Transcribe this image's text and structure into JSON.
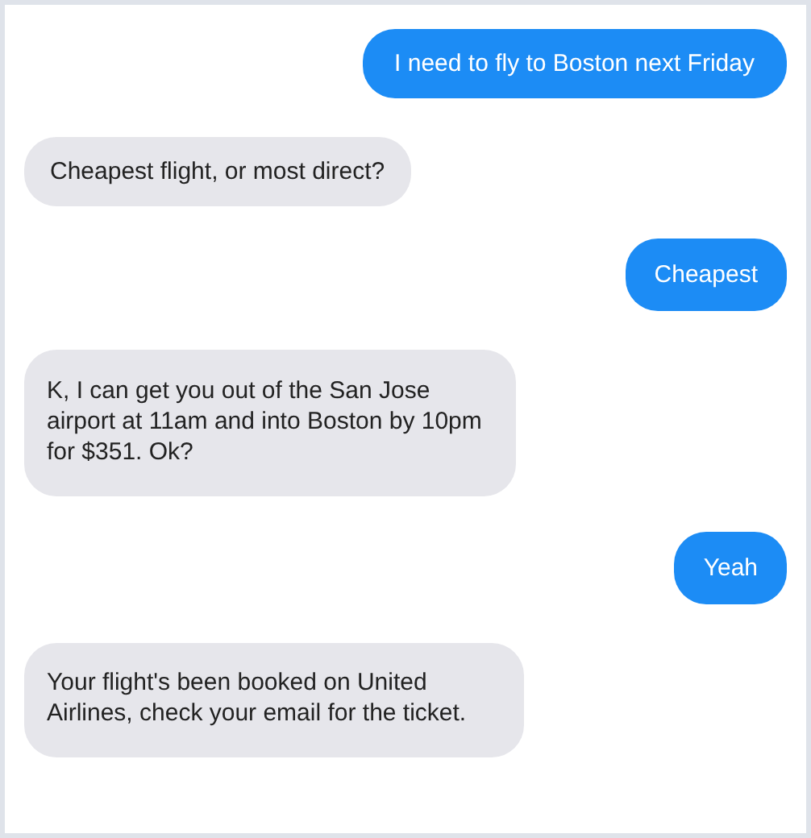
{
  "messages": [
    {
      "kind": "outgoing",
      "text": "I need to fly to Boston next Friday"
    },
    {
      "kind": "incoming",
      "text": "Cheapest flight, or most direct?"
    },
    {
      "kind": "outgoing",
      "text": "Cheapest"
    },
    {
      "kind": "incoming",
      "text": "K, I can get you out of the San Jose airport at 11am and into Boston by 10pm for $351. Ok?"
    },
    {
      "kind": "outgoing",
      "text": "Yeah"
    },
    {
      "kind": "incoming",
      "text": "Your flight's been booked on United Airlines, check your email for the ticket."
    }
  ]
}
